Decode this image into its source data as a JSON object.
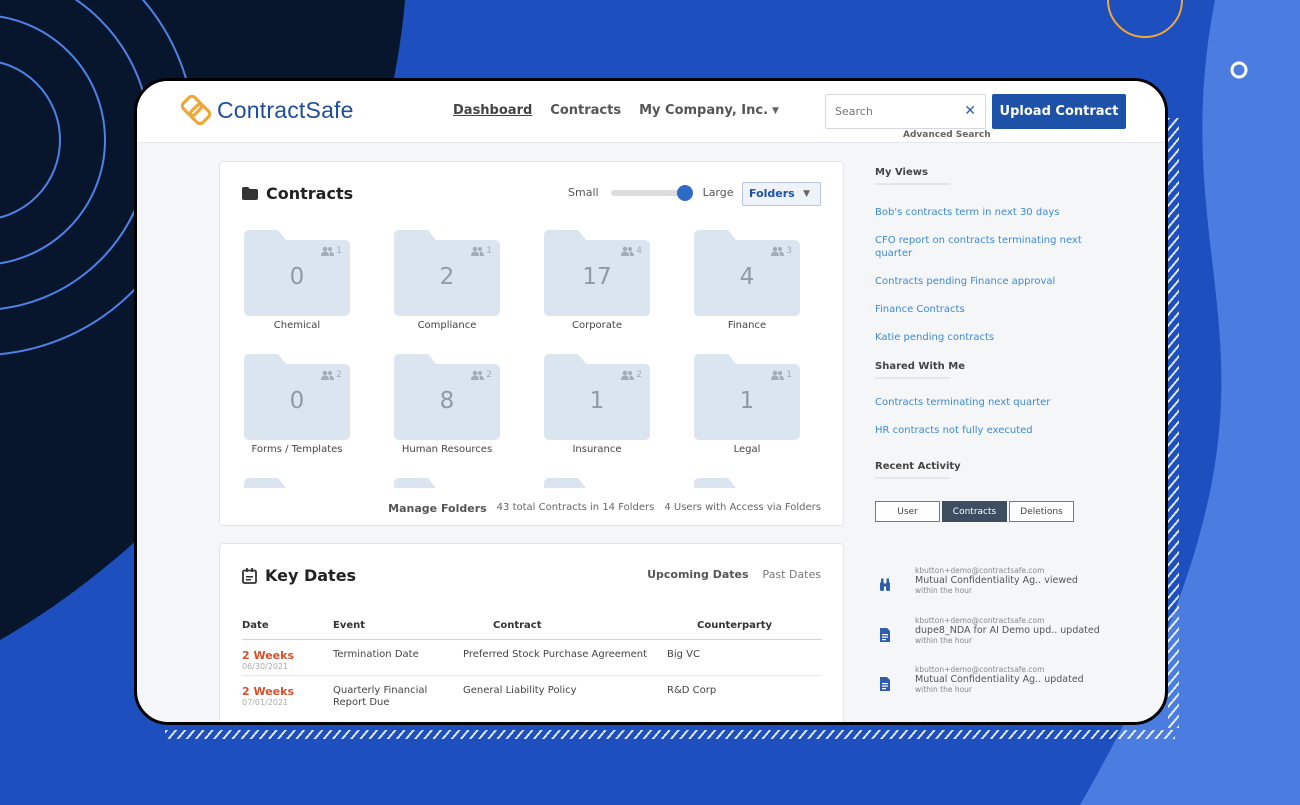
{
  "colors": {
    "brand_blue": "#1e52a8",
    "brand_orange": "#f0a73a",
    "link_blue": "#3d8ad6",
    "due_orange": "#d6502a",
    "folder_fill": "#dbe5f0"
  },
  "header": {
    "logo_text": "ContractSafe",
    "nav": {
      "dashboard": "Dashboard",
      "contracts": "Contracts",
      "company": "My Company, Inc."
    },
    "search_placeholder": "Search",
    "advanced_search": "Advanced Search",
    "upload_label": "Upload Contract"
  },
  "contracts_panel": {
    "title": "Contracts",
    "size_small": "Small",
    "size_large": "Large",
    "view_mode": "Folders",
    "folders": [
      {
        "name": "Chemical",
        "count": "0",
        "users": "1"
      },
      {
        "name": "Compliance",
        "count": "2",
        "users": "1"
      },
      {
        "name": "Corporate",
        "count": "17",
        "users": "4"
      },
      {
        "name": "Finance",
        "count": "4",
        "users": "3"
      },
      {
        "name": "Forms / Templates",
        "count": "0",
        "users": "2"
      },
      {
        "name": "Human Resources",
        "count": "8",
        "users": "2"
      },
      {
        "name": "Insurance",
        "count": "1",
        "users": "2"
      },
      {
        "name": "Legal",
        "count": "1",
        "users": "1"
      }
    ],
    "footer": {
      "manage": "Manage Folders",
      "totals": "43 total Contracts in 14 Folders",
      "access": "4 Users with Access via Folders"
    }
  },
  "key_dates": {
    "title": "Key Dates",
    "tab_upcoming": "Upcoming Dates",
    "tab_past": "Past Dates",
    "columns": {
      "date": "Date",
      "event": "Event",
      "contract": "Contract",
      "counterparty": "Counterparty"
    },
    "rows": [
      {
        "due": "2 Weeks",
        "date": "06/30/2021",
        "event": "Termination Date",
        "contract": "Preferred Stock Purchase Agreement",
        "counterparty": "Big VC"
      },
      {
        "due": "2 Weeks",
        "date": "07/01/2021",
        "event": "Quarterly Financial Report Due",
        "contract": "General Liability Policy",
        "counterparty": "R&D Corp"
      }
    ]
  },
  "sidebar": {
    "my_views_heading": "My Views",
    "my_views": [
      "Bob's contracts term in next 30 days",
      "CFO report on contracts terminating next quarter",
      "Contracts pending Finance approval",
      "Finance Contracts",
      "Katie pending contracts"
    ],
    "shared_heading": "Shared With Me",
    "shared": [
      "Contracts terminating next quarter",
      "HR contracts not fully executed"
    ],
    "activity_heading": "Recent Activity",
    "activity_tabs": {
      "user": "User",
      "contracts": "Contracts",
      "deletions": "Deletions"
    },
    "activity": [
      {
        "email": "kbutton+demo@contractsafe.com",
        "desc": "Mutual Confidentiality Ag.. viewed",
        "time": "within the hour",
        "icon": "binoculars-icon"
      },
      {
        "email": "kbutton+demo@contractsafe.com",
        "desc": "dupe8_NDA for AI Demo upd.. updated",
        "time": "within the hour",
        "icon": "document-icon"
      },
      {
        "email": "kbutton+demo@contractsafe.com",
        "desc": "Mutual Confidentiality Ag.. updated",
        "time": "within the hour",
        "icon": "document-icon"
      }
    ]
  }
}
